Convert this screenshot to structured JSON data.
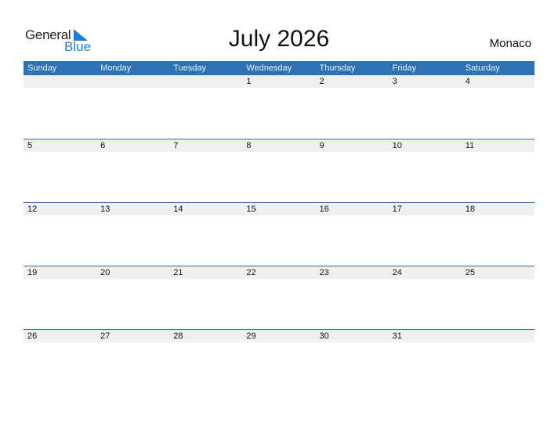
{
  "logo": {
    "general": "General",
    "blue": "Blue"
  },
  "title": "July 2026",
  "country": "Monaco",
  "days": [
    "Sunday",
    "Monday",
    "Tuesday",
    "Wednesday",
    "Thursday",
    "Friday",
    "Saturday"
  ],
  "weeks": [
    [
      "",
      "",
      "",
      "1",
      "2",
      "3",
      "4"
    ],
    [
      "5",
      "6",
      "7",
      "8",
      "9",
      "10",
      "11"
    ],
    [
      "12",
      "13",
      "14",
      "15",
      "16",
      "17",
      "18"
    ],
    [
      "19",
      "20",
      "21",
      "22",
      "23",
      "24",
      "25"
    ],
    [
      "26",
      "27",
      "28",
      "29",
      "30",
      "31",
      ""
    ]
  ]
}
